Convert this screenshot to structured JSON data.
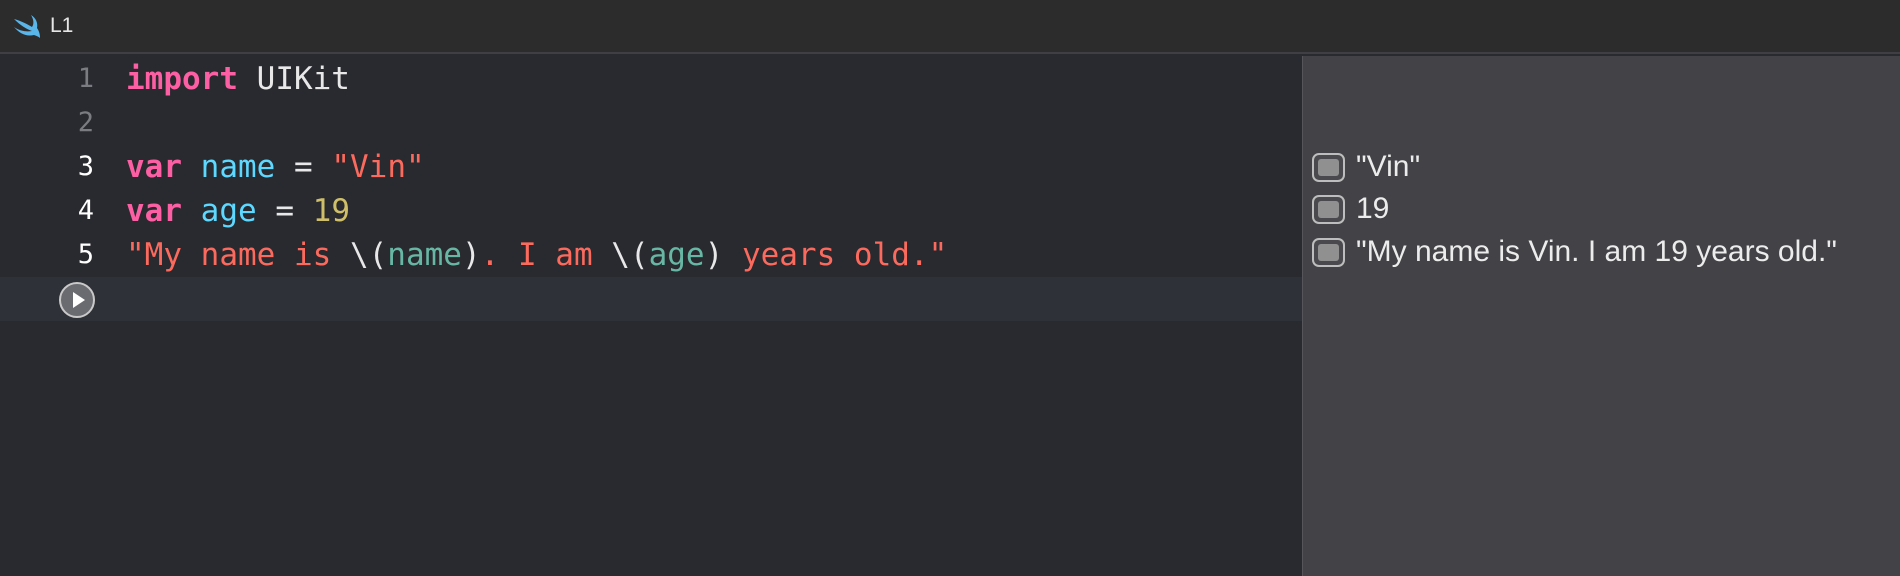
{
  "tab": {
    "title": "L1",
    "icon": "swift-icon"
  },
  "editor": {
    "lines": [
      {
        "number": "1",
        "tokens": {
          "kw": "import",
          "sp": " ",
          "mod": "UIKit"
        }
      },
      {
        "number": "2"
      },
      {
        "number": "3",
        "tokens": {
          "kw": "var",
          "sp1": " ",
          "name": "name",
          "eq": " = ",
          "value": "\"Vin\""
        }
      },
      {
        "number": "4",
        "tokens": {
          "kw": "var",
          "sp1": " ",
          "name": "age",
          "eq": " = ",
          "value": "19"
        }
      },
      {
        "number": "5",
        "tokens": {
          "s1": "\"My name is ",
          "i1open": "\\(",
          "i1": "name",
          "i1close": ")",
          "s2": ". I am ",
          "i2open": "\\(",
          "i2": "age",
          "i2close": ")",
          "s3": " years old.\""
        }
      }
    ],
    "run_icon": "play-circle-icon",
    "colors": {
      "keyword": "#fc5fa3",
      "declaration": "#5dd8ff",
      "string": "#fc6a5d",
      "number": "#d0bf69",
      "reference": "#67b7a4"
    }
  },
  "results": {
    "items": [
      {
        "icon": "quick-look-icon",
        "value": "\"Vin\""
      },
      {
        "icon": "quick-look-icon",
        "value": "19"
      },
      {
        "icon": "quick-look-icon",
        "value": "\"My name is Vin. I am 19 years old.\""
      }
    ]
  }
}
